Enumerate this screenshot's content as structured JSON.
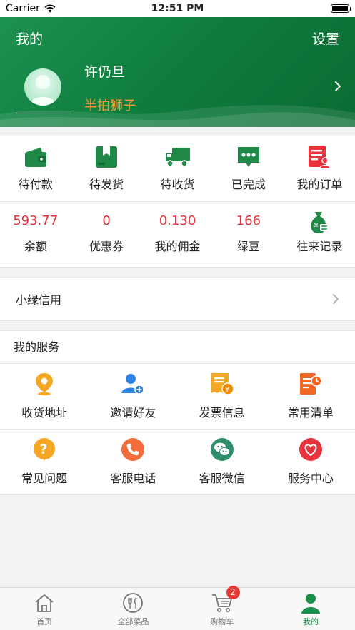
{
  "status_bar": {
    "carrier": "Carrier",
    "time": "12:51 PM",
    "battery_level": 1.0
  },
  "header": {
    "title": "我的",
    "settings_label": "设置",
    "user_name": "许仍旦",
    "nickname": "半拍狮子",
    "colors": {
      "gradient_start": "#1d9150",
      "gradient_end": "#0a6b32",
      "nickname": "#f49b33"
    }
  },
  "orders": {
    "items": [
      {
        "label": "待付款",
        "icon": "wallet-icon"
      },
      {
        "label": "待发货",
        "icon": "package-icon"
      },
      {
        "label": "待收货",
        "icon": "delivery-truck-icon"
      },
      {
        "label": "已完成",
        "icon": "chat-bubble-icon"
      },
      {
        "label": "我的订单",
        "icon": "order-list-icon"
      }
    ]
  },
  "stats": {
    "items": [
      {
        "value": "593.77",
        "label": "余额"
      },
      {
        "value": "0",
        "label": "优惠券"
      },
      {
        "value": "0.130",
        "label": "我的佣金"
      },
      {
        "value": "166",
        "label": "绿豆"
      }
    ],
    "records": {
      "label": "往来记录",
      "icon": "money-bag-icon"
    },
    "value_color": "#e8323c"
  },
  "credit": {
    "label": "小绿信用"
  },
  "services": {
    "title": "我的服务",
    "rows": [
      [
        {
          "label": "收货地址",
          "icon": "location-pin-icon"
        },
        {
          "label": "邀请好友",
          "icon": "add-friend-icon"
        },
        {
          "label": "发票信息",
          "icon": "invoice-icon"
        },
        {
          "label": "常用清单",
          "icon": "list-clock-icon"
        }
      ],
      [
        {
          "label": "常见问题",
          "icon": "question-icon"
        },
        {
          "label": "客服电话",
          "icon": "phone-icon"
        },
        {
          "label": "客服微信",
          "icon": "wechat-icon"
        },
        {
          "label": "服务中心",
          "icon": "heart-icon"
        }
      ]
    ]
  },
  "tabbar": {
    "tabs": [
      {
        "label": "首页",
        "icon": "home-icon"
      },
      {
        "label": "全部菜品",
        "icon": "all-dishes-icon"
      },
      {
        "label": "购物车",
        "icon": "cart-icon",
        "badge": "2"
      },
      {
        "label": "我的",
        "icon": "profile-icon",
        "active": true
      }
    ],
    "active_color": "#1a8f4a"
  }
}
